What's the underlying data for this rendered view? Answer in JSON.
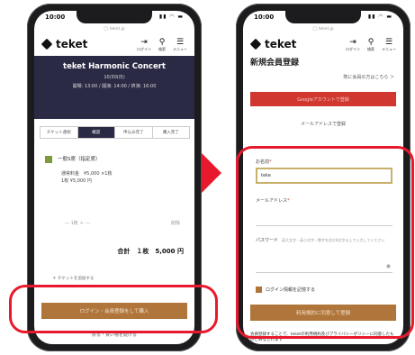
{
  "arrow_color": "#e8192c",
  "left": {
    "status": {
      "time": "10:00",
      "icons": "▮▮ ◠ ▬"
    },
    "url": "◯ teket.jp",
    "header": {
      "logo": "teket",
      "icons": [
        {
          "glyph": "⇥",
          "label": "ログイン"
        },
        {
          "glyph": "⚲",
          "label": "検索"
        },
        {
          "glyph": "☰",
          "label": "メニュー"
        }
      ]
    },
    "event": {
      "title": "teket Harmonic Concert",
      "date": "10/30(日)",
      "schedule": "開場: 13:00 / 開演: 14:00 / 終演: 16:00"
    },
    "steps": [
      "チケット選択",
      "確認",
      "申込み完了",
      "購入完了"
    ],
    "ticket": {
      "name": "一般S席（指定席）",
      "sub1": "通常料金　¥5,000 ×1枚",
      "sub2": "1枚 ¥5,000 円"
    },
    "qty": {
      "label": "― 1枚 ＋ ―",
      "action": "削除"
    },
    "total": "合計　１枚　5,000 円",
    "note": "＊ チケットを追加する",
    "cta": "ログイン・会員登録をして購入",
    "bottom": "戻る・買い物を続ける"
  },
  "right": {
    "status": {
      "time": "10:00",
      "icons": "▮▮ ◠ ▬"
    },
    "url": "◯ teket.jp",
    "header": {
      "logo": "teket",
      "icons": [
        {
          "glyph": "⇥",
          "label": "ログイン"
        },
        {
          "glyph": "⚲",
          "label": "検索"
        },
        {
          "glyph": "☰",
          "label": "メニュー"
        }
      ]
    },
    "title": "新規会員登録",
    "login_link": "既に会員の方はこちら ＞",
    "social_button": "Googleアカウントで登録",
    "mail_register": "メールアドレスで登録",
    "name_label": "お名前",
    "name_value": "teke",
    "email_label": "メールアドレス",
    "password_label": "パスワード",
    "password_hint": "英大文字・英小文字・数字を含む8文字以上で入力してください",
    "remember": "ログイン情報を記憶する",
    "submit": "利用規約に同意して登録",
    "footnote": "会員登録することで、teketの利用規約及びプライバシーポリシーに同意したものとみなされます"
  }
}
